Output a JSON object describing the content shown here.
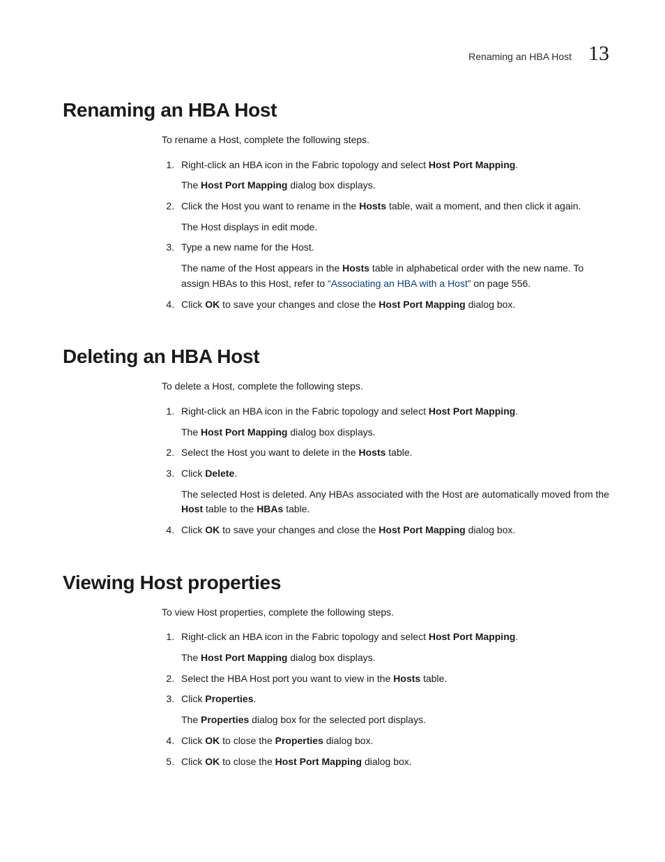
{
  "header": {
    "running_title": "Renaming an HBA Host",
    "chapter_number": "13"
  },
  "sections": [
    {
      "heading": "Renaming an HBA Host",
      "intro": "To rename a Host, complete the following steps.",
      "steps": [
        {
          "main_parts": [
            {
              "t": "Right-click an HBA icon in the Fabric topology and select "
            },
            {
              "t": "Host Port Mapping",
              "b": true
            },
            {
              "t": "."
            }
          ],
          "sub_parts": [
            {
              "t": "The "
            },
            {
              "t": "Host Port Mapping",
              "b": true
            },
            {
              "t": " dialog box displays."
            }
          ]
        },
        {
          "main_parts": [
            {
              "t": "Click the Host you want to rename in the "
            },
            {
              "t": "Hosts",
              "b": true
            },
            {
              "t": " table, wait a moment, and then click it again."
            }
          ],
          "sub_parts": [
            {
              "t": "The Host displays in edit mode."
            }
          ]
        },
        {
          "main_parts": [
            {
              "t": "Type a new name for the Host."
            }
          ],
          "sub_parts": [
            {
              "t": "The name of the Host appears in the "
            },
            {
              "t": "Hosts",
              "b": true
            },
            {
              "t": " table in alphabetical order with the new name. To assign HBAs to this Host, refer to "
            },
            {
              "t": "“Associating an HBA with a Host”",
              "link": true
            },
            {
              "t": " on page 556."
            }
          ]
        },
        {
          "main_parts": [
            {
              "t": "Click "
            },
            {
              "t": "OK",
              "b": true
            },
            {
              "t": " to save your changes and close the "
            },
            {
              "t": "Host Port Mapping",
              "b": true
            },
            {
              "t": " dialog box."
            }
          ]
        }
      ]
    },
    {
      "heading": "Deleting an HBA Host",
      "intro": "To delete a Host, complete the following steps.",
      "steps": [
        {
          "main_parts": [
            {
              "t": "Right-click an HBA icon in the Fabric topology and select "
            },
            {
              "t": "Host Port Mapping",
              "b": true
            },
            {
              "t": "."
            }
          ],
          "sub_parts": [
            {
              "t": "The "
            },
            {
              "t": "Host Port Mapping",
              "b": true
            },
            {
              "t": " dialog box displays."
            }
          ]
        },
        {
          "main_parts": [
            {
              "t": "Select the Host you want to delete in the "
            },
            {
              "t": "Hosts",
              "b": true
            },
            {
              "t": " table."
            }
          ]
        },
        {
          "main_parts": [
            {
              "t": "Click "
            },
            {
              "t": "Delete",
              "b": true
            },
            {
              "t": "."
            }
          ],
          "sub_parts": [
            {
              "t": "The selected Host is deleted. Any HBAs associated with the Host are automatically moved from the "
            },
            {
              "t": "Host",
              "b": true
            },
            {
              "t": " table to the "
            },
            {
              "t": "HBAs",
              "b": true
            },
            {
              "t": " table."
            }
          ]
        },
        {
          "main_parts": [
            {
              "t": "Click "
            },
            {
              "t": "OK",
              "b": true
            },
            {
              "t": " to save your changes and close the "
            },
            {
              "t": "Host Port Mapping",
              "b": true
            },
            {
              "t": " dialog box."
            }
          ]
        }
      ]
    },
    {
      "heading": "Viewing Host properties",
      "intro": "To view Host properties, complete the following steps.",
      "steps": [
        {
          "main_parts": [
            {
              "t": "Right-click an HBA icon in the Fabric topology and select "
            },
            {
              "t": "Host Port Mapping",
              "b": true
            },
            {
              "t": "."
            }
          ],
          "sub_parts": [
            {
              "t": "The "
            },
            {
              "t": "Host Port Mapping",
              "b": true
            },
            {
              "t": " dialog box displays."
            }
          ]
        },
        {
          "main_parts": [
            {
              "t": "Select the HBA Host port you want to view in the "
            },
            {
              "t": "Hosts",
              "b": true
            },
            {
              "t": " table."
            }
          ]
        },
        {
          "main_parts": [
            {
              "t": "Click "
            },
            {
              "t": "Properties",
              "b": true
            },
            {
              "t": "."
            }
          ],
          "sub_parts": [
            {
              "t": "The "
            },
            {
              "t": "Properties",
              "b": true
            },
            {
              "t": " dialog box for the selected port displays."
            }
          ]
        },
        {
          "main_parts": [
            {
              "t": "Click "
            },
            {
              "t": "OK",
              "b": true
            },
            {
              "t": " to close the "
            },
            {
              "t": "Properties",
              "b": true
            },
            {
              "t": " dialog box."
            }
          ]
        },
        {
          "main_parts": [
            {
              "t": "Click "
            },
            {
              "t": "OK",
              "b": true
            },
            {
              "t": " to close the "
            },
            {
              "t": "Host Port Mapping",
              "b": true
            },
            {
              "t": " dialog box."
            }
          ]
        }
      ]
    }
  ]
}
